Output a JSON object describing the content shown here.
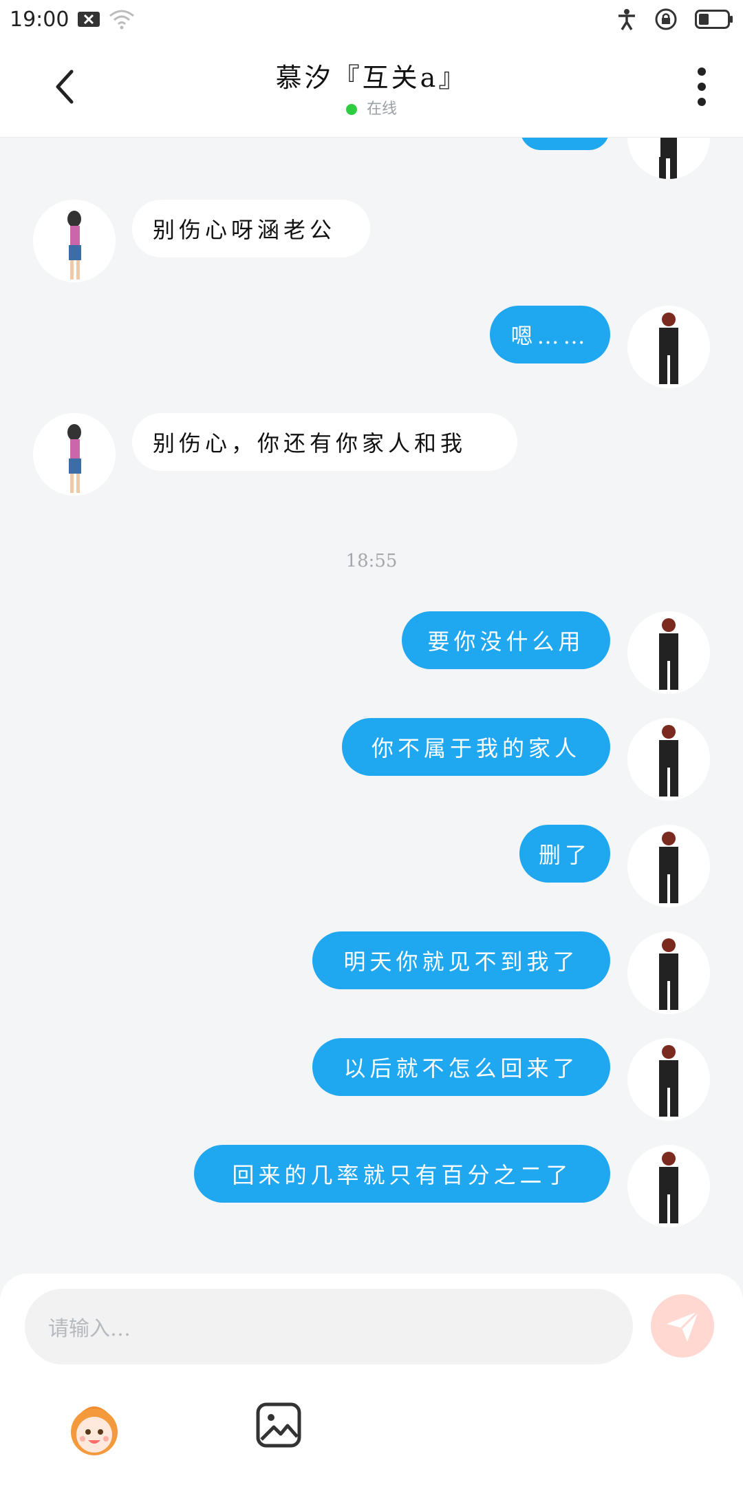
{
  "status_bar": {
    "time": "19:00",
    "left_icons": [
      "sim-x-icon",
      "wifi-icon"
    ],
    "right_icons": [
      "accessibility-icon",
      "lock-icon",
      "battery-icon"
    ]
  },
  "header": {
    "title": "慕汐『互关a』",
    "status": "在线"
  },
  "messages": [
    {
      "side": "in",
      "text": "别伤心呀涵老公"
    },
    {
      "side": "out",
      "text": "嗯……"
    },
    {
      "side": "in",
      "text": "别伤心，你还有你家人和我"
    },
    {
      "side": "out",
      "text": "要你没什么用"
    },
    {
      "side": "out",
      "text": "你不属于我的家人"
    },
    {
      "side": "out",
      "text": "删了"
    },
    {
      "side": "out",
      "text": "明天你就见不到我了"
    },
    {
      "side": "out",
      "text": "以后就不怎么回来了"
    },
    {
      "side": "out",
      "text": "回来的几率就只有百分之二了"
    }
  ],
  "timestamp": "18:55",
  "composer": {
    "placeholder": "请输入…"
  },
  "icons": {
    "back": "back-arrow-icon",
    "more": "more-vert-icon",
    "send": "send-icon",
    "emoji": "emoji-icon",
    "image": "image-icon"
  },
  "colors": {
    "bubble_out": "#1fa7f0",
    "bubble_in": "#ffffff",
    "online": "#2ecc40",
    "send_disabled": "#ffd8d2"
  }
}
